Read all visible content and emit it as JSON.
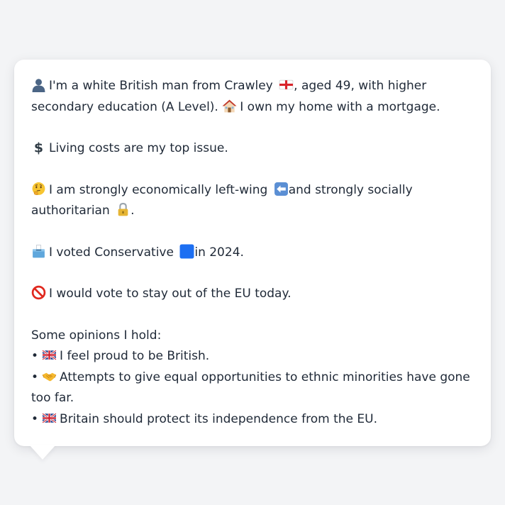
{
  "profile": {
    "identity": {
      "icon": "person-silhouette-icon",
      "text_1": "I'm a white British man from Crawley",
      "flag_icon": "england-flag-icon",
      "text_2": ", aged 49, with higher secondary education (A Level).",
      "home_icon": "house-icon",
      "text_3": "I own my home with a mortgage."
    },
    "top_issue": {
      "icon": "dollar-sign-icon",
      "text": "Living costs are my top issue."
    },
    "ideology": {
      "icon": "thinking-face-icon",
      "text_1": "I am strongly economically left-wing",
      "left_icon": "left-arrow-icon",
      "text_2": "and strongly socially authoritarian",
      "lock_icon": "lock-icon",
      "text_3": "."
    },
    "vote_2024": {
      "icon": "ballot-box-icon",
      "text_1": "I voted Conservative",
      "party_icon": "blue-square-icon",
      "text_2": "in 2024."
    },
    "eu_vote": {
      "icon": "prohibited-icon",
      "text": "I would vote to stay out of the EU today."
    },
    "opinions": {
      "heading": "Some opinions I hold:",
      "bullet": "•",
      "items": [
        {
          "icon": "uk-flag-icon",
          "text": "I feel proud to be British."
        },
        {
          "icon": "handshake-icon",
          "text": "Attempts to give equal opportunities to ethnic minorities have gone too far."
        },
        {
          "icon": "uk-flag-icon",
          "text": "Britain should protect its independence from the EU."
        }
      ]
    }
  },
  "colors": {
    "background": "#f3f4f6",
    "bubble": "#ffffff",
    "text": "#1f2937",
    "party_blue": "#1d6ff2",
    "england_red": "#d8232a"
  }
}
